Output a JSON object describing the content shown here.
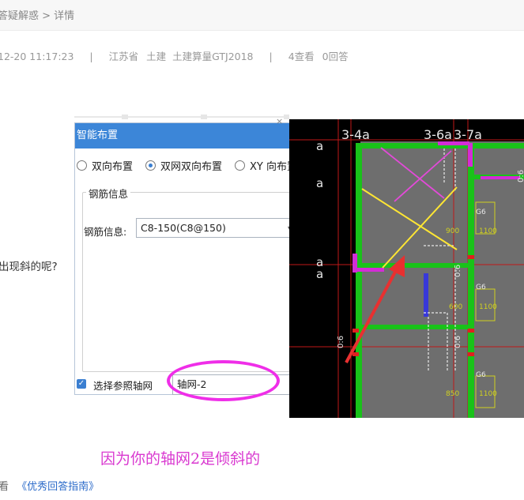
{
  "breadcrumb": "答疑解惑 > 详情",
  "meta": {
    "datetime": "12-20 11:17:23",
    "sep1": "|",
    "region": "江苏省",
    "cat1": "土建",
    "cat2": "土建算量GTJ2018",
    "sep2": "|",
    "views": "4查看",
    "answers": "0回答"
  },
  "question_fragment": "出现斜的呢?",
  "dialog": {
    "title": "智能布置",
    "radio1": "双向布置",
    "radio2": "双网双向布置",
    "radio3": "XY 向布置",
    "group_title": "钢筋信息",
    "rebar_label": "钢筋信息:",
    "rebar_value": "C8-150(C8@150)",
    "checkbox_label": "选择参照轴网",
    "axis_value": "轴网-2",
    "close_glyph": "×",
    "selected_radio": 2
  },
  "cad": {
    "labels": [
      "3-4a",
      "3-6a",
      "3-7a"
    ],
    "side_labels": [
      "a",
      "a",
      "a",
      "a"
    ],
    "tags": [
      "900",
      "1100",
      "600",
      "1100",
      "850",
      "1100"
    ],
    "rebar_marks": [
      "G6",
      "G6",
      "G6"
    ],
    "vertical_marks": [
      "0:6",
      "0:6",
      "0:6",
      "0:6"
    ]
  },
  "answer": "因为你的轴网2是倾斜的",
  "footer": {
    "prefix": "看",
    "link": "《优秀回答指南》"
  },
  "colors": {
    "dialog_title_bg": "#3c86d8",
    "answer": "#d939d0",
    "ellipse": "#ef2ee8",
    "link": "#2a6ac9"
  }
}
